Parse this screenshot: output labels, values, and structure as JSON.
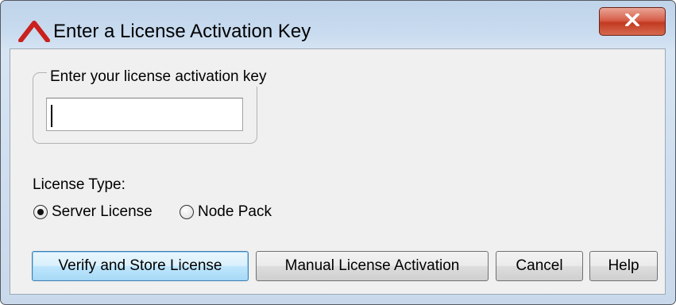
{
  "window": {
    "title": "Enter a License Activation Key",
    "accent_color": "#c9211e",
    "close_icon": "close-icon"
  },
  "key_group": {
    "label": "Enter your license activation key",
    "key_value": "",
    "key_placeholder": ""
  },
  "license_type": {
    "label": "License Type:",
    "options": [
      {
        "label": "Server License",
        "selected": true
      },
      {
        "label": "Node Pack",
        "selected": false
      }
    ]
  },
  "buttons": {
    "verify": "Verify and Store License",
    "manual": "Manual License Activation",
    "cancel": "Cancel",
    "help": "Help"
  }
}
